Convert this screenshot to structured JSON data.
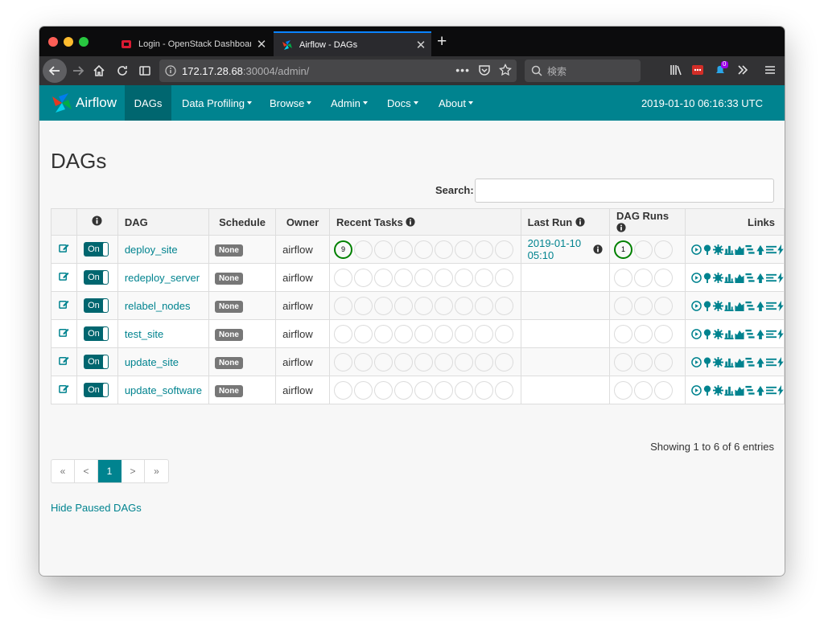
{
  "browser": {
    "tabs": [
      {
        "title": "Login - OpenStack Dashboard",
        "active": false
      },
      {
        "title": "Airflow - DAGs",
        "active": true
      }
    ],
    "url_host": "172.17.28.68",
    "url_rest": ":30004/admin/",
    "search_placeholder": "検索",
    "notification_count": "0",
    "colors": {
      "tab_accent": "#0a84ff",
      "toolbar": "#323234",
      "tabstrip": "#0c0c0d"
    }
  },
  "navbar": {
    "brand": "Airflow",
    "items": [
      {
        "label": "DAGs",
        "active": true,
        "dropdown": false
      },
      {
        "label": "Data Profiling",
        "active": false,
        "dropdown": true
      },
      {
        "label": "Browse",
        "active": false,
        "dropdown": true
      },
      {
        "label": "Admin",
        "active": false,
        "dropdown": true
      },
      {
        "label": "Docs",
        "active": false,
        "dropdown": true
      },
      {
        "label": "About",
        "active": false,
        "dropdown": true
      }
    ],
    "clock": "2019-01-10 06:16:33 UTC",
    "colors": {
      "bar": "#00838f",
      "active": "#00666f"
    }
  },
  "page": {
    "title": "DAGs",
    "search_label": "Search:",
    "search_value": ""
  },
  "table": {
    "headers": {
      "info_icon": "info-icon",
      "dag": "DAG",
      "schedule": "Schedule",
      "owner": "Owner",
      "recent_tasks": "Recent Tasks",
      "last_run": "Last Run",
      "dag_runs": "DAG Runs",
      "links": "Links"
    },
    "rows": [
      {
        "toggle": "On",
        "dag": "deploy_site",
        "schedule": "None",
        "owner": "airflow",
        "recent_tasks_success": "9",
        "last_run": "2019-01-10 05:10",
        "dag_runs_success": "1"
      },
      {
        "toggle": "On",
        "dag": "redeploy_server",
        "schedule": "None",
        "owner": "airflow",
        "recent_tasks_success": "",
        "last_run": "",
        "dag_runs_success": ""
      },
      {
        "toggle": "On",
        "dag": "relabel_nodes",
        "schedule": "None",
        "owner": "airflow",
        "recent_tasks_success": "",
        "last_run": "",
        "dag_runs_success": ""
      },
      {
        "toggle": "On",
        "dag": "test_site",
        "schedule": "None",
        "owner": "airflow",
        "recent_tasks_success": "",
        "last_run": "",
        "dag_runs_success": ""
      },
      {
        "toggle": "On",
        "dag": "update_site",
        "schedule": "None",
        "owner": "airflow",
        "recent_tasks_success": "",
        "last_run": "",
        "dag_runs_success": ""
      },
      {
        "toggle": "On",
        "dag": "update_software",
        "schedule": "None",
        "owner": "airflow",
        "recent_tasks_success": "",
        "last_run": "",
        "dag_runs_success": ""
      }
    ],
    "link_icons": [
      "play-circle-icon",
      "tree-icon",
      "graph-icon",
      "bar-chart-icon",
      "area-chart-icon",
      "gantt-icon",
      "code-icon",
      "logs-icon",
      "refresh-icon"
    ]
  },
  "footer": {
    "summary": "Showing 1 to 6 of 6 entries",
    "pager": [
      "«",
      "<",
      "1",
      ">",
      "»"
    ],
    "pager_active": "1",
    "hide_paused": "Hide Paused DAGs"
  }
}
